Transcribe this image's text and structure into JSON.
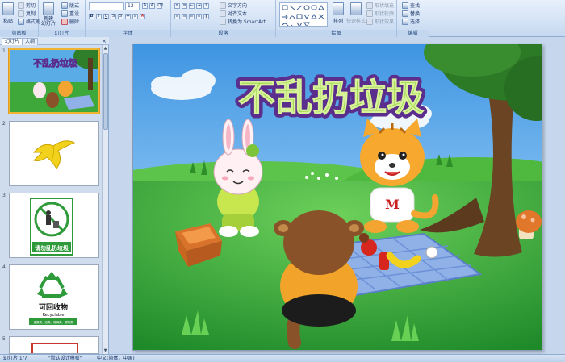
{
  "ribbon": {
    "clipboard": {
      "paste": "粘贴",
      "cut": "剪切",
      "copy": "复制",
      "format_painter": "格式刷",
      "label": "剪贴板"
    },
    "slides": {
      "new_slide": "新建\n幻灯片",
      "layout": "版式",
      "reset": "重设",
      "delete": "删除",
      "label": "幻灯片"
    },
    "font": {
      "font_name": "",
      "font_size": "12",
      "label": "字体"
    },
    "paragraph": {
      "text_direction": "文字方向",
      "align_text": "对齐文本",
      "smartart": "转换为 SmartArt",
      "label": "段落"
    },
    "drawing": {
      "arrange": "排列",
      "quick_styles": "快速样式",
      "shape_fill": "形状填充",
      "shape_outline": "形状轮廓",
      "shape_effects": "形状效果",
      "label": "绘图"
    },
    "editing": {
      "find": "查找",
      "replace": "替换",
      "select": "选择",
      "label": "编辑"
    }
  },
  "pane": {
    "tabs": [
      "幻灯片",
      "大纲"
    ],
    "close": "×",
    "slides": [
      {
        "number": "1",
        "thumb_title": "不乱扔垃圾"
      },
      {
        "number": "2"
      },
      {
        "number": "3",
        "caption": "请勿乱扔垃圾"
      },
      {
        "number": "4",
        "caption": "可回收物",
        "caption_en": "Recyclable",
        "caption_small": "金属类、纸类、玻璃类、塑料类"
      },
      {
        "number": "5"
      }
    ]
  },
  "slide": {
    "title": "不乱扔垃圾",
    "shirt_letter": "M"
  },
  "status": {
    "slide_of": "幻灯片 1/7",
    "theme": "\"默认设计模板\"",
    "language": "中文(简体，中国)"
  },
  "colors": {
    "sky_top": "#4fa3e8",
    "grass": "#3ea93a",
    "title_fill": "#9bd34a",
    "title_outline": "#5b2d8c",
    "accent_selection": "#f0b433"
  }
}
